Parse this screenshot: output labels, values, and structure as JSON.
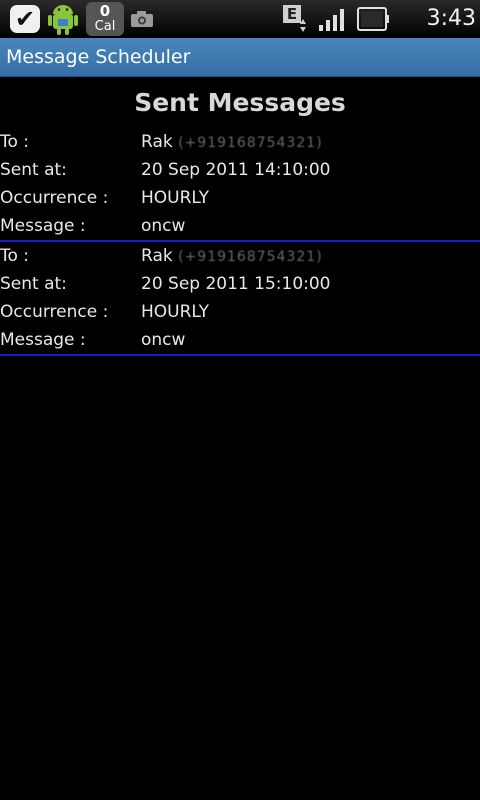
{
  "status_bar": {
    "cal_count": "0",
    "cal_label": "Cal",
    "data_badge": "E",
    "time": "3:43 PM",
    "icons": [
      "check-icon",
      "android-icon",
      "calendar-icon",
      "camera-icon",
      "data-edge-icon",
      "signal-icon",
      "battery-icon"
    ]
  },
  "app": {
    "title": "Message Scheduler",
    "accent_color": "#336ea4",
    "divider_color": "#1a1ac8"
  },
  "page": {
    "heading": "Sent Messages"
  },
  "labels": {
    "to": "To :",
    "sent_at": "Sent at:",
    "occurrence": "Occurrence :",
    "message": "Message :"
  },
  "messages": [
    {
      "to_name": "Rak",
      "to_redacted": "(+919168754321)",
      "sent_at": "20 Sep 2011 14:10:00",
      "occurrence": "HOURLY",
      "message": "oncw"
    },
    {
      "to_name": "Rak",
      "to_redacted": "(+919168754321)",
      "sent_at": "20 Sep 2011 15:10:00",
      "occurrence": "HOURLY",
      "message": "oncw"
    }
  ]
}
